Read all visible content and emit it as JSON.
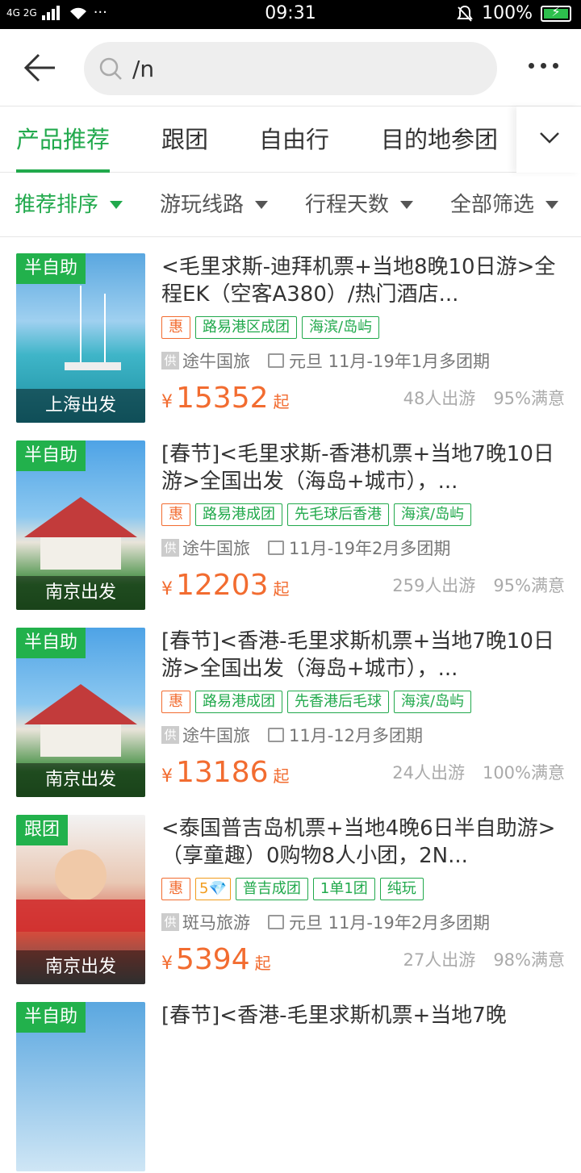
{
  "status_bar": {
    "network": "4G 2G",
    "time": "09:31",
    "battery": "100%"
  },
  "search": {
    "query": "/n"
  },
  "tabs": [
    "产品推荐",
    "跟团",
    "自由行",
    "目的地参团"
  ],
  "filters": [
    "推荐排序",
    "游玩线路",
    "行程天数",
    "全部筛选"
  ],
  "items": [
    {
      "badge": "半自助",
      "depart": "上海出发",
      "title": "<毛里求斯-迪拜机票+当地8晚10日游>全程EK（空客A380）/热门酒店...",
      "tags": [
        "惠",
        "路易港区成团",
        "海滨/岛屿"
      ],
      "supplier": "途牛国旅",
      "schedule": "元旦 11月-19年1月多团期",
      "price": "15352",
      "travelers": "48人出游",
      "satisfaction": "95%满意"
    },
    {
      "badge": "半自助",
      "depart": "南京出发",
      "title": "[春节]<毛里求斯-香港机票+当地7晚10日游>全国出发（海岛+城市），...",
      "tags": [
        "惠",
        "路易港成团",
        "先毛球后香港",
        "海滨/岛屿"
      ],
      "supplier": "途牛国旅",
      "schedule": "11月-19年2月多团期",
      "price": "12203",
      "travelers": "259人出游",
      "satisfaction": "95%满意"
    },
    {
      "badge": "半自助",
      "depart": "南京出发",
      "title": "[春节]<香港-毛里求斯机票+当地7晚10日游>全国出发（海岛+城市），...",
      "tags": [
        "惠",
        "路易港成团",
        "先香港后毛球",
        "海滨/岛屿"
      ],
      "supplier": "途牛国旅",
      "schedule": "11月-12月多团期",
      "price": "13186",
      "travelers": "24人出游",
      "satisfaction": "100%满意"
    },
    {
      "badge": "跟团",
      "depart": "南京出发",
      "title": "<泰国普吉岛机票+当地4晚6日半自助游>（享童趣）0购物8人小团，2N...",
      "tags": [
        "惠",
        "5💎",
        "普吉成团",
        "1单1团",
        "纯玩"
      ],
      "supplier": "斑马旅游",
      "schedule": "元旦 11月-19年2月多团期",
      "price": "5394",
      "travelers": "27人出游",
      "satisfaction": "98%满意"
    },
    {
      "badge": "半自助",
      "depart": "",
      "title": "[春节]<香港-毛里求斯机票+当地7晚",
      "tags": [],
      "supplier": "",
      "schedule": "",
      "price": "",
      "travelers": "",
      "satisfaction": ""
    }
  ],
  "labels": {
    "yen": "¥",
    "qi": "起",
    "supplier_icon": "供"
  },
  "colors": {
    "accent": "#21a94c",
    "price": "#f26c30"
  }
}
